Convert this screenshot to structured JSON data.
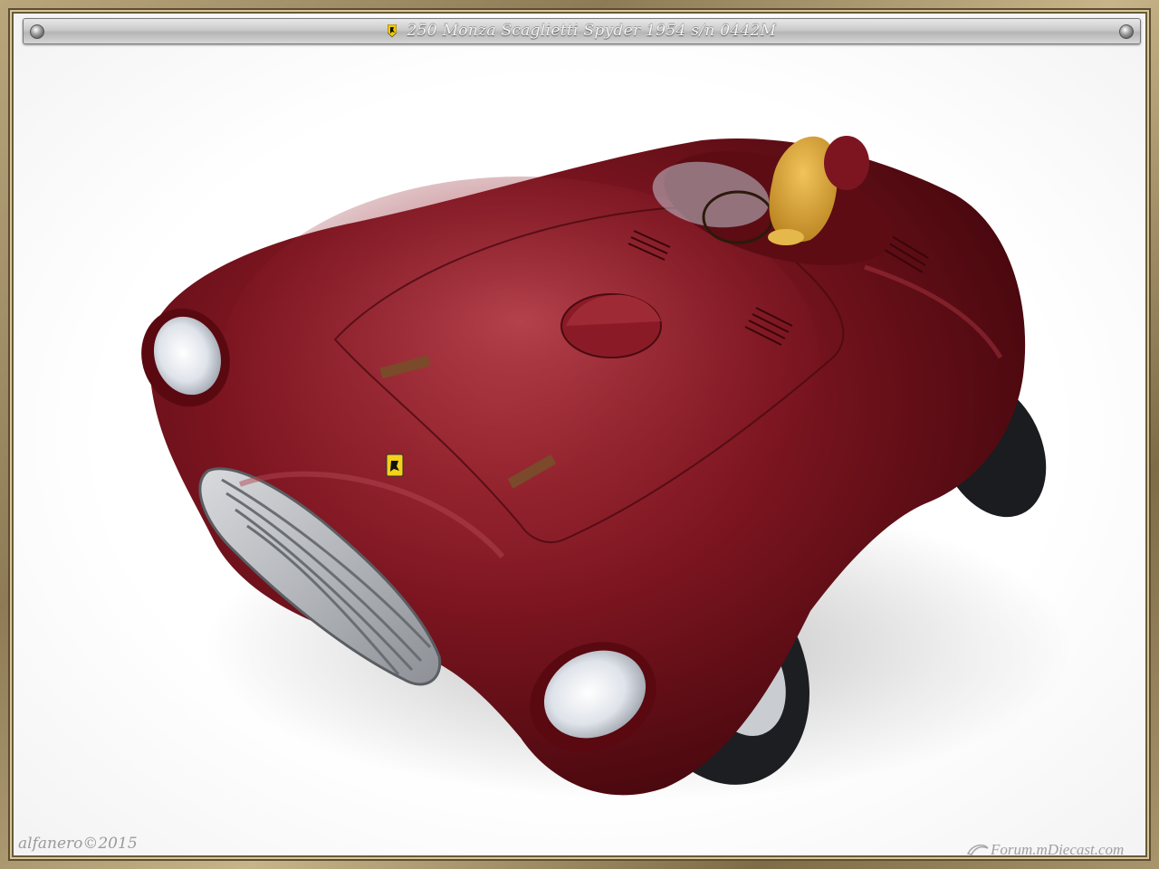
{
  "title": {
    "text": "250 Monza Scaglietti Spyder 1954  s/n 0442M",
    "logo_icon": "prancing-horse-shield-icon"
  },
  "photo": {
    "subject": "burgundy-sports-car-model",
    "body_color": "#6e0f17",
    "seat_color": "#d9a63a"
  },
  "signature": "alfanero©2015",
  "watermark": "Forum.mDiecast.com",
  "colors": {
    "frame": "#a8956c",
    "title_bar": "#c9c9c9",
    "background": "#ffffff"
  }
}
